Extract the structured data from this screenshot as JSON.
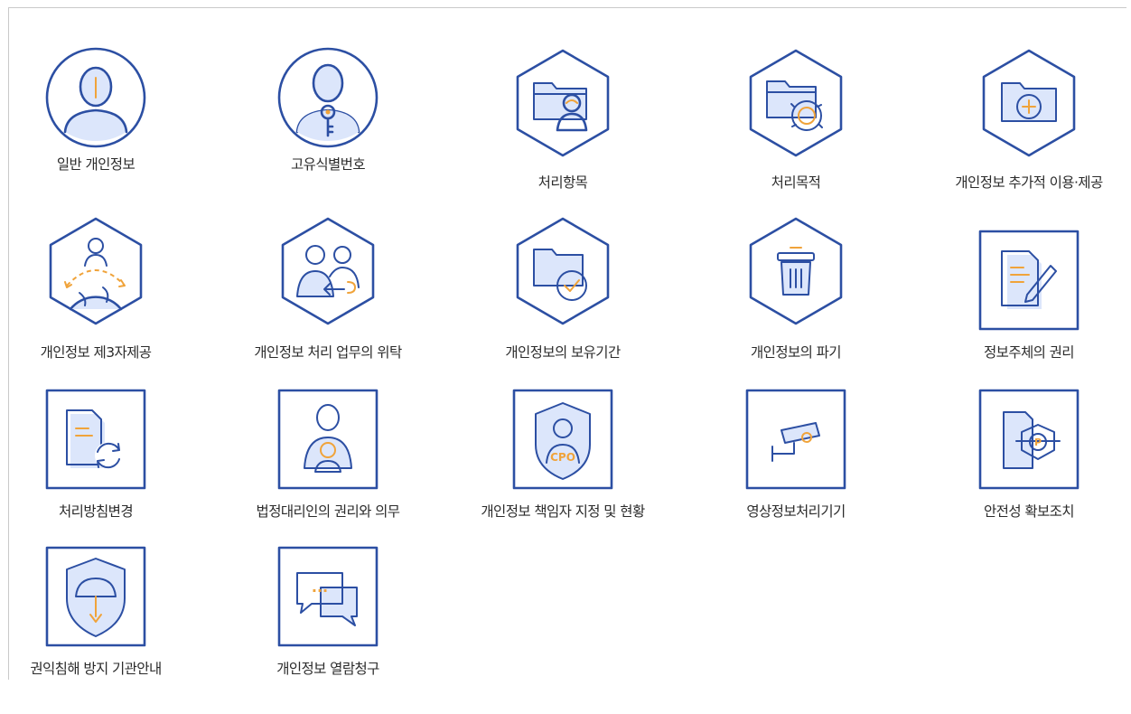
{
  "colors": {
    "accent": "#2c4fa3",
    "fill": "#dce6fb",
    "highlight": "#f0a33a"
  },
  "items": [
    {
      "label": "일반 개인정보",
      "icon": "person-circle-icon"
    },
    {
      "label": "고유식별번호",
      "icon": "person-key-icon"
    },
    {
      "label": "처리항목",
      "icon": "folder-person-icon"
    },
    {
      "label": "처리목적",
      "icon": "folder-gear-icon"
    },
    {
      "label": "개인정보 추가적 이용·제공",
      "icon": "folder-plus-icon"
    },
    {
      "label": "개인정보 제3자제공",
      "icon": "globe-person-icon"
    },
    {
      "label": "개인정보 처리 업무의 위탁",
      "icon": "people-transfer-icon"
    },
    {
      "label": "개인정보의 보유기간",
      "icon": "folder-clock-icon"
    },
    {
      "label": "개인정보의 파기",
      "icon": "trash-icon"
    },
    {
      "label": "정보주체의 권리",
      "icon": "document-pen-icon"
    },
    {
      "label": "처리방침변경",
      "icon": "document-refresh-icon"
    },
    {
      "label": "법정대리인의 권리와 의무",
      "icon": "guardian-icon"
    },
    {
      "label": "개인정보 책임자 지정 및 현황",
      "icon": "cpo-shield-icon",
      "badge": "CPO"
    },
    {
      "label": "영상정보처리기기",
      "icon": "cctv-icon"
    },
    {
      "label": "안전성 확보조치",
      "icon": "document-lock-icon"
    },
    {
      "label": "권익침해 방지 기관안내",
      "icon": "umbrella-shield-icon"
    },
    {
      "label": "개인정보 열람청구",
      "icon": "chat-bubbles-icon",
      "bubble_text": "..."
    }
  ]
}
